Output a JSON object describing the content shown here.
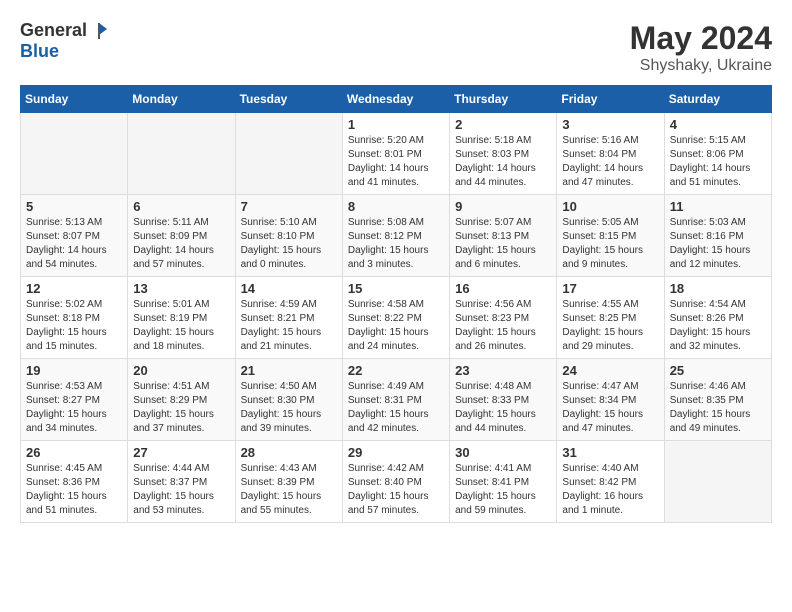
{
  "logo": {
    "general": "General",
    "blue": "Blue"
  },
  "title": {
    "month_year": "May 2024",
    "location": "Shyshaky, Ukraine"
  },
  "days_of_week": [
    "Sunday",
    "Monday",
    "Tuesday",
    "Wednesday",
    "Thursday",
    "Friday",
    "Saturday"
  ],
  "weeks": [
    [
      {
        "day": "",
        "info": ""
      },
      {
        "day": "",
        "info": ""
      },
      {
        "day": "",
        "info": ""
      },
      {
        "day": "1",
        "info": "Sunrise: 5:20 AM\nSunset: 8:01 PM\nDaylight: 14 hours\nand 41 minutes."
      },
      {
        "day": "2",
        "info": "Sunrise: 5:18 AM\nSunset: 8:03 PM\nDaylight: 14 hours\nand 44 minutes."
      },
      {
        "day": "3",
        "info": "Sunrise: 5:16 AM\nSunset: 8:04 PM\nDaylight: 14 hours\nand 47 minutes."
      },
      {
        "day": "4",
        "info": "Sunrise: 5:15 AM\nSunset: 8:06 PM\nDaylight: 14 hours\nand 51 minutes."
      }
    ],
    [
      {
        "day": "5",
        "info": "Sunrise: 5:13 AM\nSunset: 8:07 PM\nDaylight: 14 hours\nand 54 minutes."
      },
      {
        "day": "6",
        "info": "Sunrise: 5:11 AM\nSunset: 8:09 PM\nDaylight: 14 hours\nand 57 minutes."
      },
      {
        "day": "7",
        "info": "Sunrise: 5:10 AM\nSunset: 8:10 PM\nDaylight: 15 hours\nand 0 minutes."
      },
      {
        "day": "8",
        "info": "Sunrise: 5:08 AM\nSunset: 8:12 PM\nDaylight: 15 hours\nand 3 minutes."
      },
      {
        "day": "9",
        "info": "Sunrise: 5:07 AM\nSunset: 8:13 PM\nDaylight: 15 hours\nand 6 minutes."
      },
      {
        "day": "10",
        "info": "Sunrise: 5:05 AM\nSunset: 8:15 PM\nDaylight: 15 hours\nand 9 minutes."
      },
      {
        "day": "11",
        "info": "Sunrise: 5:03 AM\nSunset: 8:16 PM\nDaylight: 15 hours\nand 12 minutes."
      }
    ],
    [
      {
        "day": "12",
        "info": "Sunrise: 5:02 AM\nSunset: 8:18 PM\nDaylight: 15 hours\nand 15 minutes."
      },
      {
        "day": "13",
        "info": "Sunrise: 5:01 AM\nSunset: 8:19 PM\nDaylight: 15 hours\nand 18 minutes."
      },
      {
        "day": "14",
        "info": "Sunrise: 4:59 AM\nSunset: 8:21 PM\nDaylight: 15 hours\nand 21 minutes."
      },
      {
        "day": "15",
        "info": "Sunrise: 4:58 AM\nSunset: 8:22 PM\nDaylight: 15 hours\nand 24 minutes."
      },
      {
        "day": "16",
        "info": "Sunrise: 4:56 AM\nSunset: 8:23 PM\nDaylight: 15 hours\nand 26 minutes."
      },
      {
        "day": "17",
        "info": "Sunrise: 4:55 AM\nSunset: 8:25 PM\nDaylight: 15 hours\nand 29 minutes."
      },
      {
        "day": "18",
        "info": "Sunrise: 4:54 AM\nSunset: 8:26 PM\nDaylight: 15 hours\nand 32 minutes."
      }
    ],
    [
      {
        "day": "19",
        "info": "Sunrise: 4:53 AM\nSunset: 8:27 PM\nDaylight: 15 hours\nand 34 minutes."
      },
      {
        "day": "20",
        "info": "Sunrise: 4:51 AM\nSunset: 8:29 PM\nDaylight: 15 hours\nand 37 minutes."
      },
      {
        "day": "21",
        "info": "Sunrise: 4:50 AM\nSunset: 8:30 PM\nDaylight: 15 hours\nand 39 minutes."
      },
      {
        "day": "22",
        "info": "Sunrise: 4:49 AM\nSunset: 8:31 PM\nDaylight: 15 hours\nand 42 minutes."
      },
      {
        "day": "23",
        "info": "Sunrise: 4:48 AM\nSunset: 8:33 PM\nDaylight: 15 hours\nand 44 minutes."
      },
      {
        "day": "24",
        "info": "Sunrise: 4:47 AM\nSunset: 8:34 PM\nDaylight: 15 hours\nand 47 minutes."
      },
      {
        "day": "25",
        "info": "Sunrise: 4:46 AM\nSunset: 8:35 PM\nDaylight: 15 hours\nand 49 minutes."
      }
    ],
    [
      {
        "day": "26",
        "info": "Sunrise: 4:45 AM\nSunset: 8:36 PM\nDaylight: 15 hours\nand 51 minutes."
      },
      {
        "day": "27",
        "info": "Sunrise: 4:44 AM\nSunset: 8:37 PM\nDaylight: 15 hours\nand 53 minutes."
      },
      {
        "day": "28",
        "info": "Sunrise: 4:43 AM\nSunset: 8:39 PM\nDaylight: 15 hours\nand 55 minutes."
      },
      {
        "day": "29",
        "info": "Sunrise: 4:42 AM\nSunset: 8:40 PM\nDaylight: 15 hours\nand 57 minutes."
      },
      {
        "day": "30",
        "info": "Sunrise: 4:41 AM\nSunset: 8:41 PM\nDaylight: 15 hours\nand 59 minutes."
      },
      {
        "day": "31",
        "info": "Sunrise: 4:40 AM\nSunset: 8:42 PM\nDaylight: 16 hours\nand 1 minute."
      },
      {
        "day": "",
        "info": ""
      }
    ]
  ]
}
